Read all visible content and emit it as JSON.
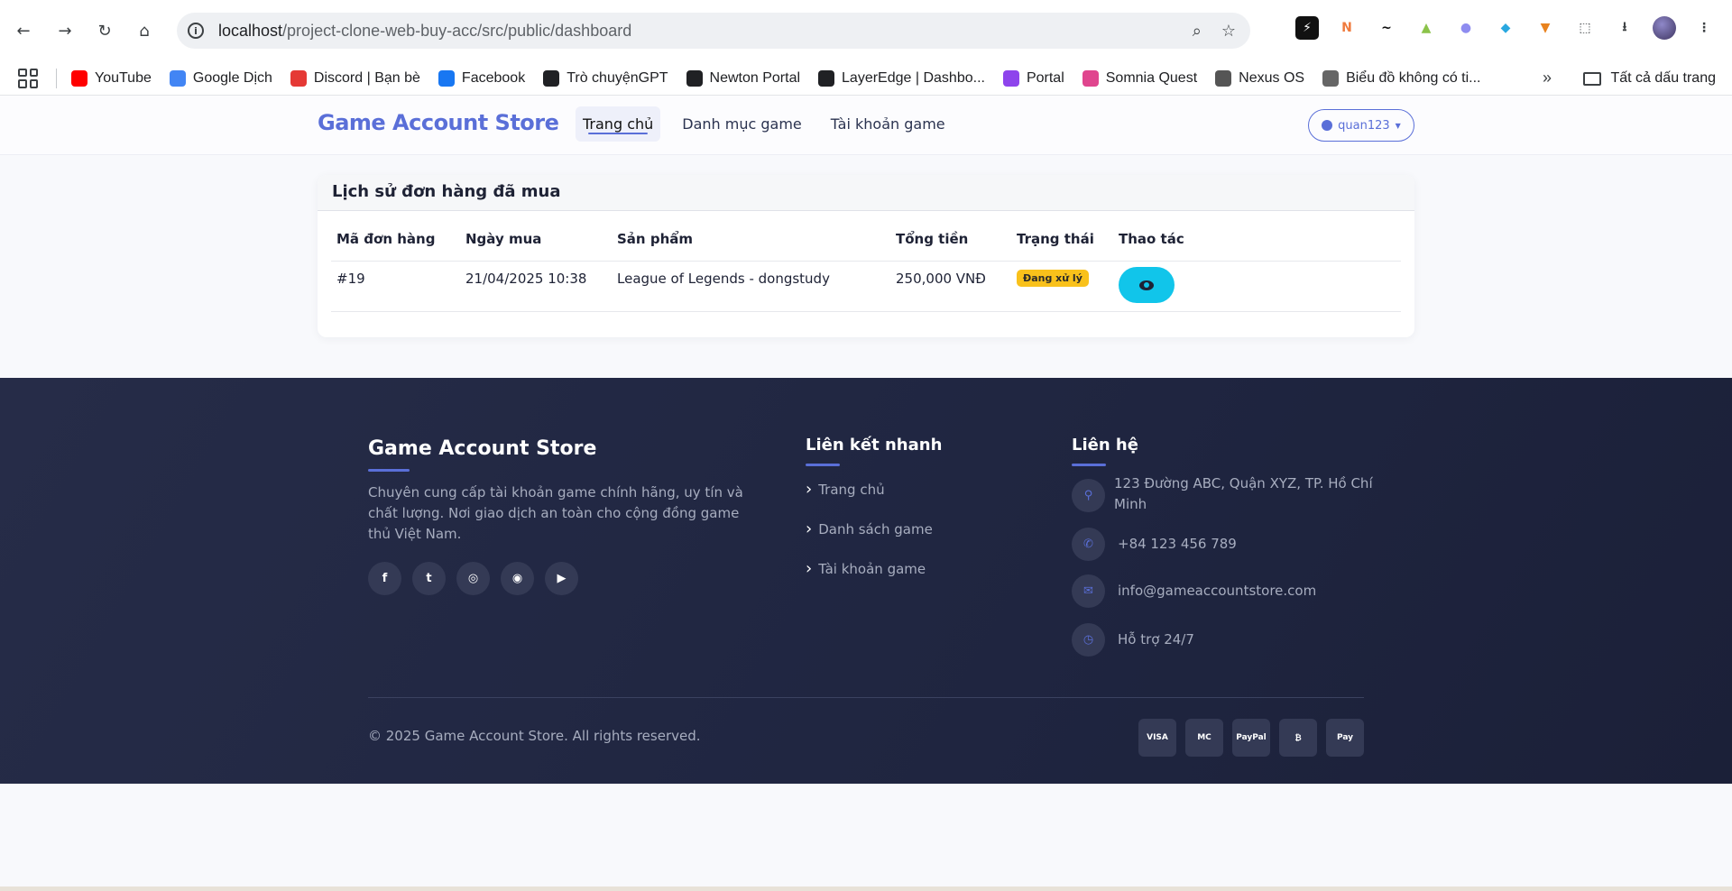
{
  "browser": {
    "url_host": "localhost",
    "url_path": "/project-clone-web-buy-acc/src/public/dashboard",
    "bookmarks": [
      {
        "label": "YouTube",
        "color": "#ff0000",
        "icon": "youtube-icon"
      },
      {
        "label": "Google Dịch",
        "color": "#4285f4",
        "icon": "google-translate-icon"
      },
      {
        "label": "Discord | Bạn bè",
        "color": "#e53935",
        "icon": "discord-icon"
      },
      {
        "label": "Facebook",
        "color": "#1877f2",
        "icon": "facebook-icon"
      },
      {
        "label": "Trò chuyệnGPT",
        "color": "#202124",
        "icon": "chatgpt-icon"
      },
      {
        "label": "Newton Portal",
        "color": "#202124",
        "icon": "newton-icon"
      },
      {
        "label": "LayerEdge | Dashbo...",
        "color": "#202124",
        "icon": "layeredge-icon"
      },
      {
        "label": "Portal",
        "color": "#8e44ec",
        "icon": "portal-icon"
      },
      {
        "label": "Somnia Quest",
        "color": "#e0458e",
        "icon": "somnia-icon"
      },
      {
        "label": "Nexus OS",
        "color": "#555555",
        "icon": "nexus-icon"
      },
      {
        "label": "Biểu đồ không có ti...",
        "color": "#666666",
        "icon": "chart-icon"
      }
    ],
    "all_bookmarks": "Tất cả dấu trang"
  },
  "header": {
    "brand": "Game Account Store",
    "nav": [
      {
        "label": "Trang chủ",
        "active": true
      },
      {
        "label": "Danh mục game",
        "active": false
      },
      {
        "label": "Tài khoản game",
        "active": false
      }
    ],
    "user": "quan123"
  },
  "orders": {
    "title": "Lịch sử đơn hàng đã mua",
    "columns": [
      "Mã đơn hàng",
      "Ngày mua",
      "Sản phẩm",
      "Tổng tiền",
      "Trạng thái",
      "Thao tác"
    ],
    "rows": [
      {
        "id": "#19",
        "date": "21/04/2025 10:38",
        "product": "League of Legends - dongstudy",
        "total": "250,000 VNĐ",
        "status": "Đang xử lý"
      }
    ]
  },
  "footer": {
    "brand": "Game Account Store",
    "description": "Chuyên cung cấp tài khoản game chính hãng, uy tín và chất lượng. Nơi giao dịch an toàn cho cộng đồng game thủ Việt Nam.",
    "social": [
      "facebook-icon",
      "twitter-icon",
      "instagram-icon",
      "discord-icon",
      "youtube-icon"
    ],
    "quick_links_title": "Liên kết nhanh",
    "quick_links": [
      "Trang chủ",
      "Danh sách game",
      "Tài khoản game"
    ],
    "contact_title": "Liên hệ",
    "contact": [
      {
        "icon": "location-pin-icon",
        "text": "123 Đường ABC, Quận XYZ, TP. Hồ Chí Minh"
      },
      {
        "icon": "phone-icon",
        "text": "+84 123 456 789"
      },
      {
        "icon": "envelope-icon",
        "text": "info@gameaccountstore.com"
      },
      {
        "icon": "clock-icon",
        "text": "Hỗ trợ 24/7"
      }
    ],
    "copyright": "© 2025 Game Account Store. All rights reserved.",
    "payments": [
      "VISA",
      "MC",
      "PayPal",
      "₿",
      "Pay"
    ]
  },
  "colors": {
    "accent": "#5a6fd8",
    "footer_bg": "#232944",
    "badge": "#f9c11b",
    "view_button": "#11c5ea"
  }
}
